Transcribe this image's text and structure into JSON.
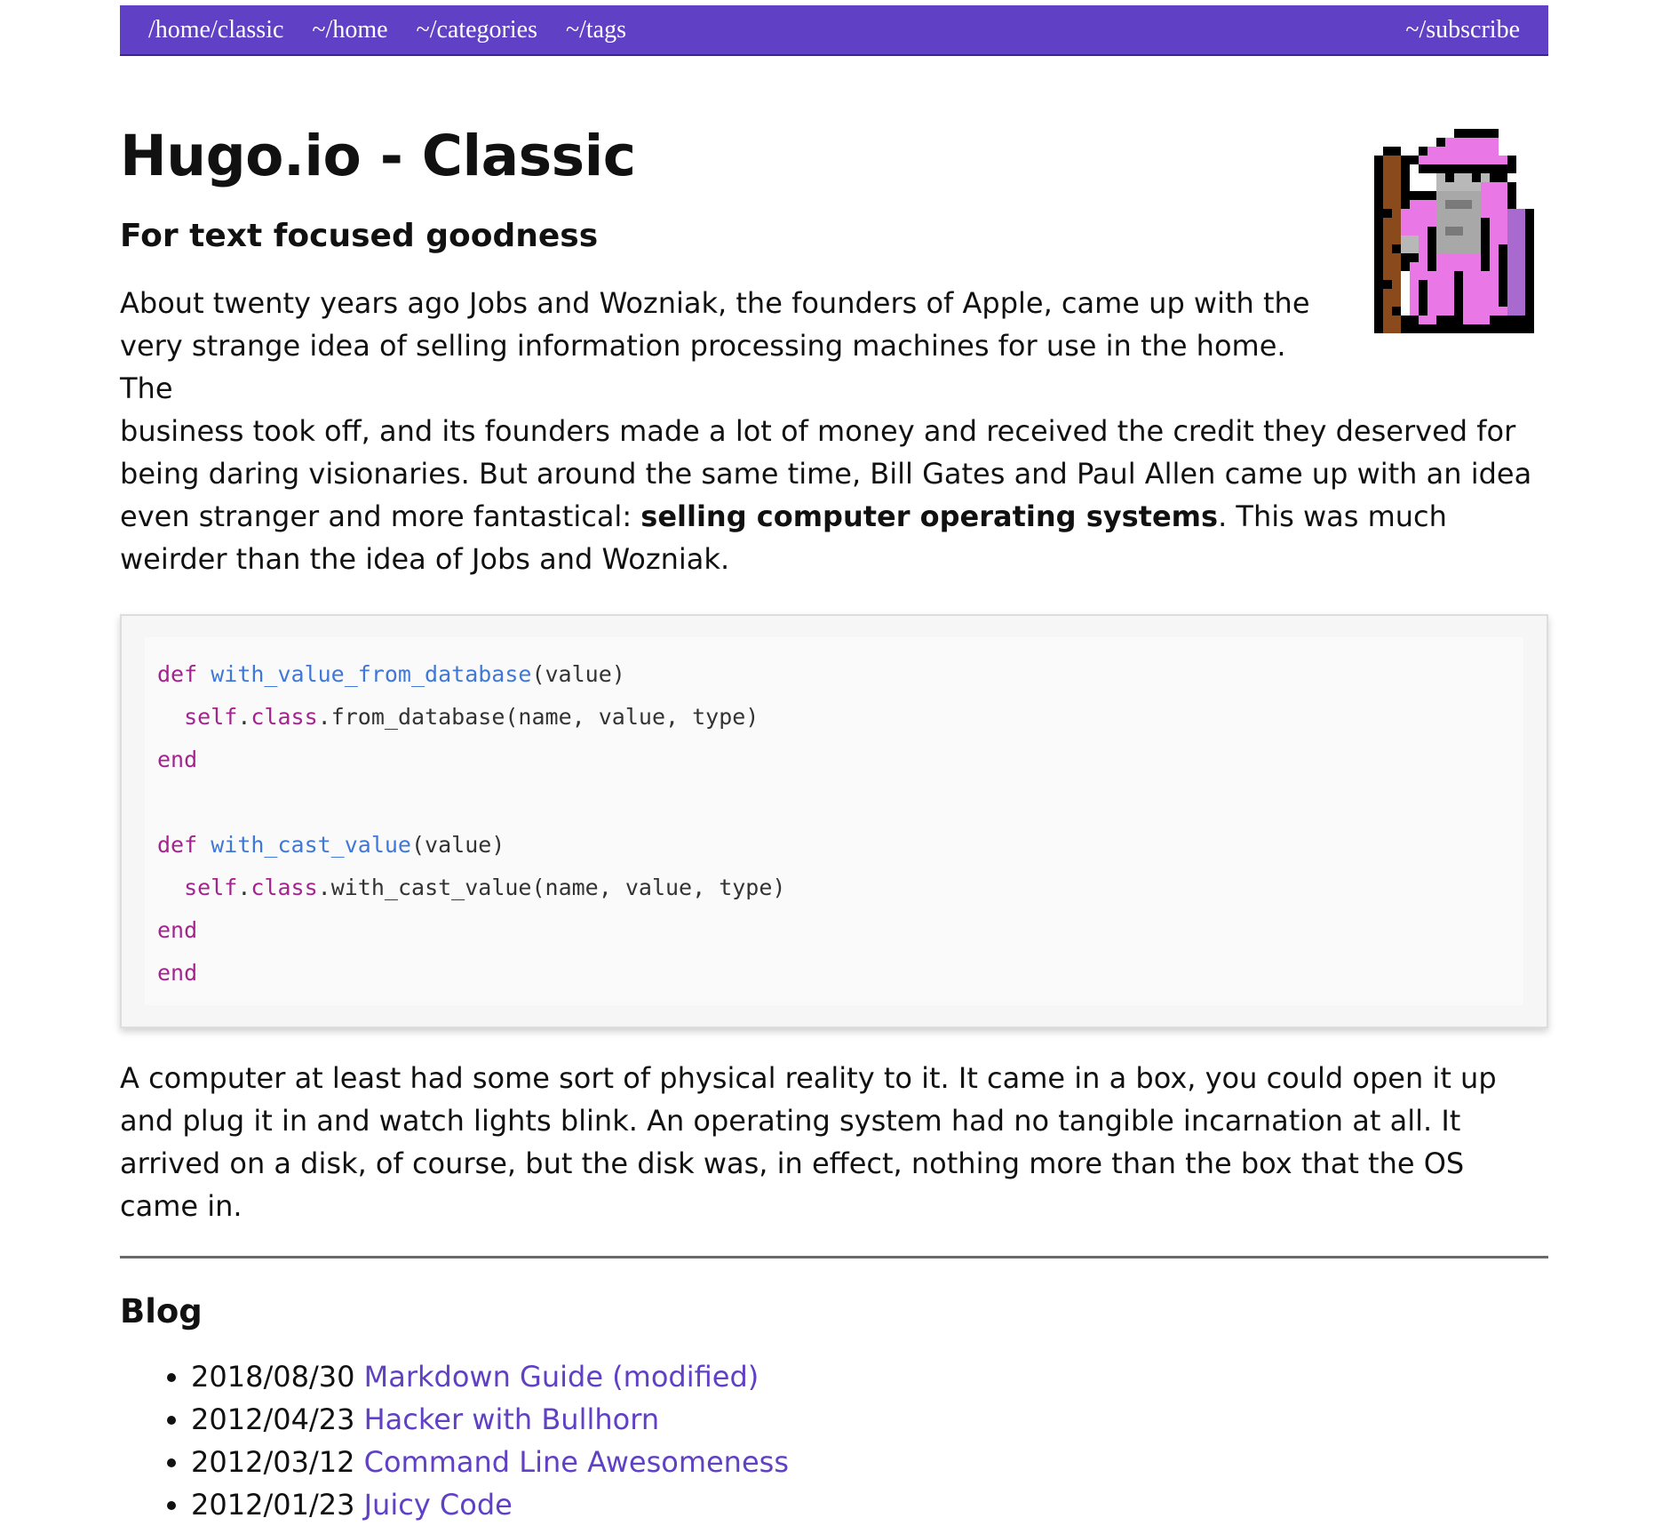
{
  "nav": {
    "brand": "/home/classic",
    "items": [
      "~/home",
      "~/categories",
      "~/tags"
    ],
    "subscribe": "~/subscribe"
  },
  "hero": {
    "title": "Hugo.io - Classic",
    "tagline": "For text focused goodness",
    "avatar_icon": "wizard-icon"
  },
  "intro": {
    "line1": "About twenty years ago Jobs and Wozniak, the founders of Apple, came up with the very strange idea of selling information processing machines for use in the home. The",
    "rest_before": "business took off, and its founders made a lot of money and received the credit they deserved for being daring visionaries. But around the same time, Bill Gates and Paul Allen came up with an idea even stranger and more fantastical: ",
    "bold": "selling computer operating systems",
    "rest_after": ". This was much weirder than the idea of Jobs and Wozniak."
  },
  "code": {
    "lines": [
      {
        "kw": "def ",
        "fn": "with_value_from_database",
        "rest": "(value)"
      },
      {
        "indent": "  ",
        "self": "self",
        "dot": ".",
        "cls": "class",
        "rest": ".from_database(name, value, type)"
      },
      {
        "kw": "end"
      },
      {},
      {
        "kw": "def ",
        "fn": "with_cast_value",
        "rest": "(value)"
      },
      {
        "indent": "  ",
        "self": "self",
        "dot": ".",
        "cls": "class",
        "rest": ".with_cast_value(name, value, type)"
      },
      {
        "kw": "end"
      },
      {
        "kw": "end"
      }
    ]
  },
  "after": "A computer at least had some sort of physical reality to it. It came in a box, you could open it up and plug it in and watch lights blink. An operating system had no tangible incarnation at all. It arrived on a disk, of course, but the disk was, in effect, nothing more than the box that the OS came in.",
  "blog": {
    "heading": "Blog",
    "posts": [
      {
        "date": "2018/08/30",
        "title": "Markdown Guide (modified)"
      },
      {
        "date": "2012/04/23",
        "title": "Hacker with Bullhorn"
      },
      {
        "date": "2012/03/12",
        "title": "Command Line Awesomeness"
      },
      {
        "date": "2012/01/23",
        "title": "Juicy Code"
      }
    ]
  },
  "colors": {
    "nav_bg": "#6040c4",
    "link": "#6040c4",
    "keyword": "#a4238f",
    "function": "#3f78d8",
    "wizard_robe": "#e978e6"
  }
}
